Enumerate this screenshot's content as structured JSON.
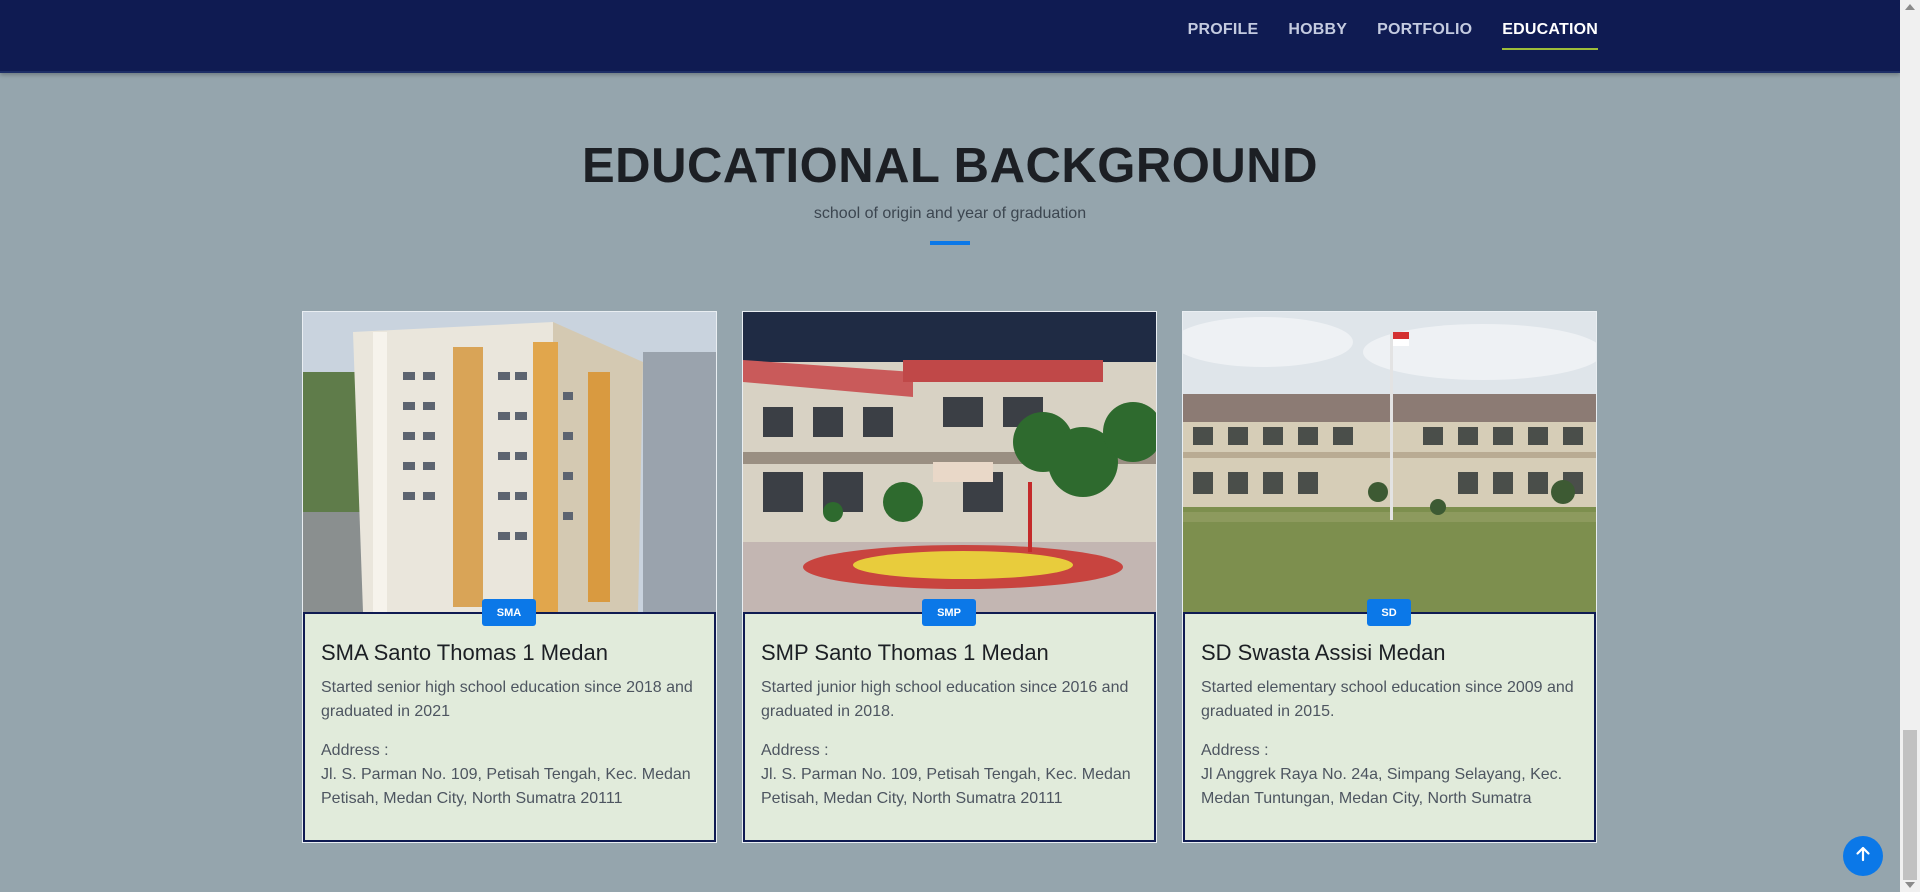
{
  "nav": {
    "items": [
      {
        "label": "PROFILE"
      },
      {
        "label": "HOBBY"
      },
      {
        "label": "PORTFOLIO"
      },
      {
        "label": "EDUCATION"
      }
    ],
    "active": "EDUCATION"
  },
  "section": {
    "title": "EDUCATIONAL BACKGROUND",
    "subtitle": "school of origin and year of graduation"
  },
  "cards": [
    {
      "badge": "SMA",
      "title": "SMA Santo Thomas 1 Medan",
      "text": "Started senior high school education since 2018 and graduated in 2021",
      "address_label": "Address :",
      "address": "Jl. S. Parman No. 109, Petisah Tengah, Kec. Medan Petisah, Medan City, North Sumatra 20111"
    },
    {
      "badge": "SMP",
      "title": "SMP Santo Thomas 1 Medan",
      "text": "Started junior high school education since 2016 and graduated in 2018.",
      "address_label": "Address :",
      "address": "Jl. S. Parman No. 109, Petisah Tengah, Kec. Medan Petisah, Medan City, North Sumatra 20111"
    },
    {
      "badge": "SD",
      "title": "SD Swasta Assisi Medan",
      "text": "Started elementary school education since 2009 and graduated in 2015.",
      "address_label": "Address :",
      "address": "Jl Anggrek Raya No. 24a, Simpang Selayang, Kec. Medan Tuntungan, Medan City, North Sumatra"
    }
  ],
  "colors": {
    "navbar": "#0f1b52",
    "background": "#95a5ad",
    "accent": "#0b78e8",
    "card": "#e1ebdb"
  },
  "icons": {
    "back_to_top": "arrow-up-icon"
  }
}
